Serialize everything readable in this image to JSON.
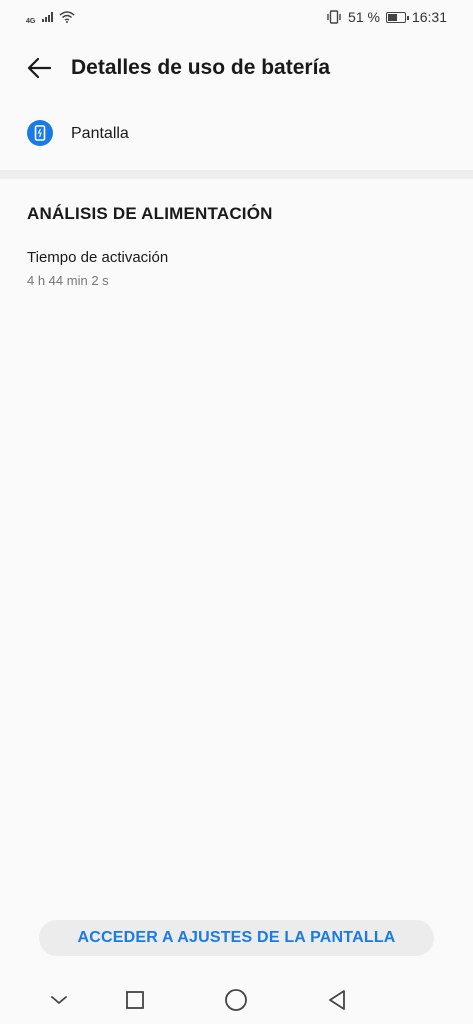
{
  "status_bar": {
    "network_label": "4G",
    "battery_percent": "51 %",
    "battery_level": 0.51,
    "time": "16:31",
    "icons": [
      "signal-icon",
      "wifi-icon",
      "vibrate-icon",
      "battery-icon"
    ]
  },
  "header": {
    "title": "Detalles de uso de batería",
    "back_icon": "back-arrow-icon"
  },
  "app": {
    "label": "Pantalla",
    "icon": "screen-icon",
    "icon_color": "#1a7ae6"
  },
  "section": {
    "title": "ANÁLISIS DE ALIMENTACIÓN",
    "metric_label": "Tiempo de activación",
    "metric_value": "4 h 44 min 2 s"
  },
  "action": {
    "label": "ACCEDER A AJUSTES DE LA PANTALLA",
    "color": "#1a7ae6"
  },
  "nav_bar": {
    "icons": [
      "chevron-down-icon",
      "recents-icon",
      "home-icon",
      "back-icon"
    ]
  }
}
